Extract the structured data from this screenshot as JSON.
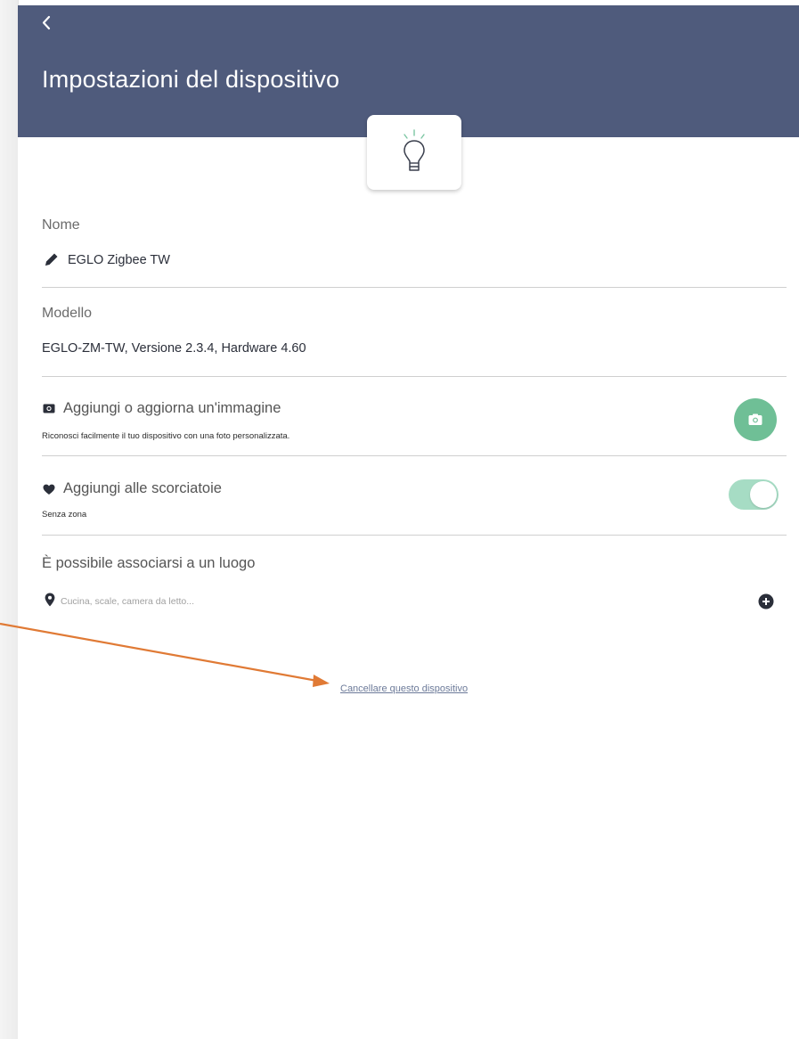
{
  "header": {
    "title": "Impostazioni del dispositivo",
    "back_icon": "chevron-left-icon",
    "background_color": "#4f5b7c",
    "device_icon": "lightbulb-icon"
  },
  "name_section": {
    "label": "Nome",
    "value": "EGLO Zigbee TW",
    "icon": "pencil-icon"
  },
  "model_section": {
    "label": "Modello",
    "value": "EGLO-ZM-TW, Versione 2.3.4, Hardware 4.60"
  },
  "image_section": {
    "title": "Aggiungi o aggiorna un'immagine",
    "subtitle": "Riconosci facilmente il tuo dispositivo con una foto personalizzata.",
    "icon": "camera-icon",
    "button_color": "#6fbf96"
  },
  "shortcuts_section": {
    "title": "Aggiungi alle scorciatoie",
    "subtitle": "Senza zona",
    "icon": "heart-icon",
    "toggle_on": true,
    "toggle_color": "#a6dcc4"
  },
  "location_section": {
    "title": "È possibile associarsi a un luogo",
    "placeholder": "Cucina, scale, camera da letto...",
    "icon": "location-pin-icon",
    "add_icon": "plus-circle-icon"
  },
  "delete_link": {
    "label": "Cancellare questo dispositivo",
    "color": "#6c7a99"
  },
  "annotation": {
    "arrow_color": "#e07a35"
  }
}
